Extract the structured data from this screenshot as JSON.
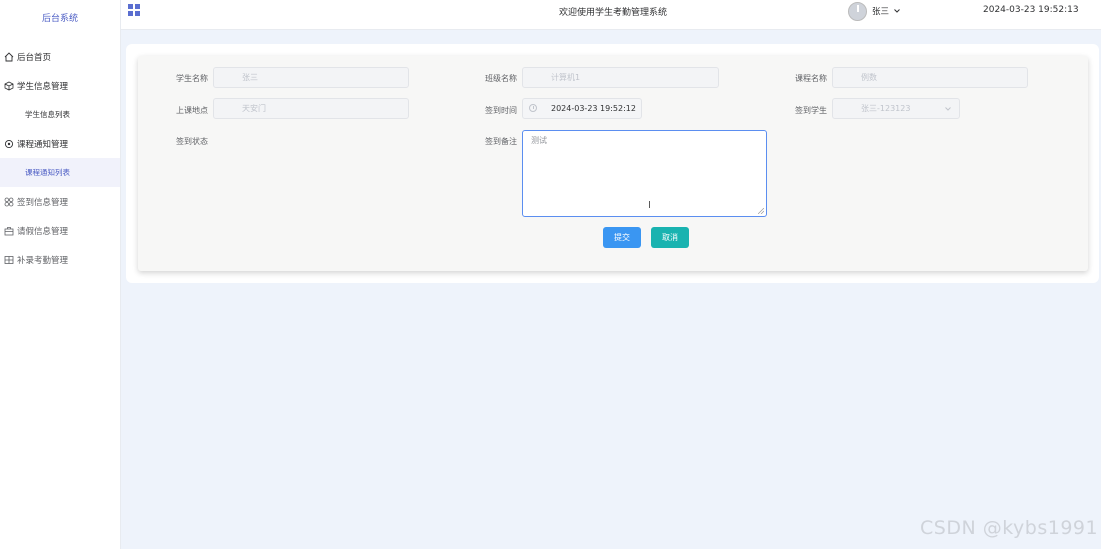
{
  "sidebar": {
    "brand": "后台系统",
    "items": [
      {
        "label": "后台首页",
        "icon": "home-icon"
      },
      {
        "label": "学生信息管理",
        "icon": "cube-icon"
      },
      {
        "label": "学生信息列表",
        "sub": true
      },
      {
        "label": "课程通知管理",
        "icon": "settings-icon"
      },
      {
        "label": "课程通知列表",
        "sub": true,
        "active": true
      },
      {
        "label": "签到信息管理",
        "icon": "apps-icon"
      },
      {
        "label": "请假信息管理",
        "icon": "briefcase-icon"
      },
      {
        "label": "补录考勤管理",
        "icon": "grid-icon"
      }
    ]
  },
  "header": {
    "title": "欢迎使用学生考勤管理系统",
    "user_name": "张三",
    "datetime": "2024-03-23 19:52:13"
  },
  "form": {
    "student_name": {
      "label": "学生名称",
      "value": "张三"
    },
    "class_name": {
      "label": "班级名称",
      "value": "计算机1"
    },
    "course_name": {
      "label": "课程名称",
      "value": "例数"
    },
    "location": {
      "label": "上课地点",
      "value": "天安门"
    },
    "checkin_time": {
      "label": "签到时间",
      "value": "2024-03-23 19:52:12"
    },
    "checkin_student": {
      "label": "签到学生",
      "value": "张三-123123"
    },
    "checkin_status": {
      "label": "签到状态"
    },
    "remark": {
      "label": "签到备注",
      "value": "测试"
    },
    "submit_label": "提交",
    "cancel_label": "取消"
  },
  "watermark": "CSDN @kybs1991",
  "colors": {
    "accent": "#4b5cc4",
    "submit": "#3a96f2",
    "cancel": "#19b3b0",
    "focus_border": "#5b8ef0"
  }
}
